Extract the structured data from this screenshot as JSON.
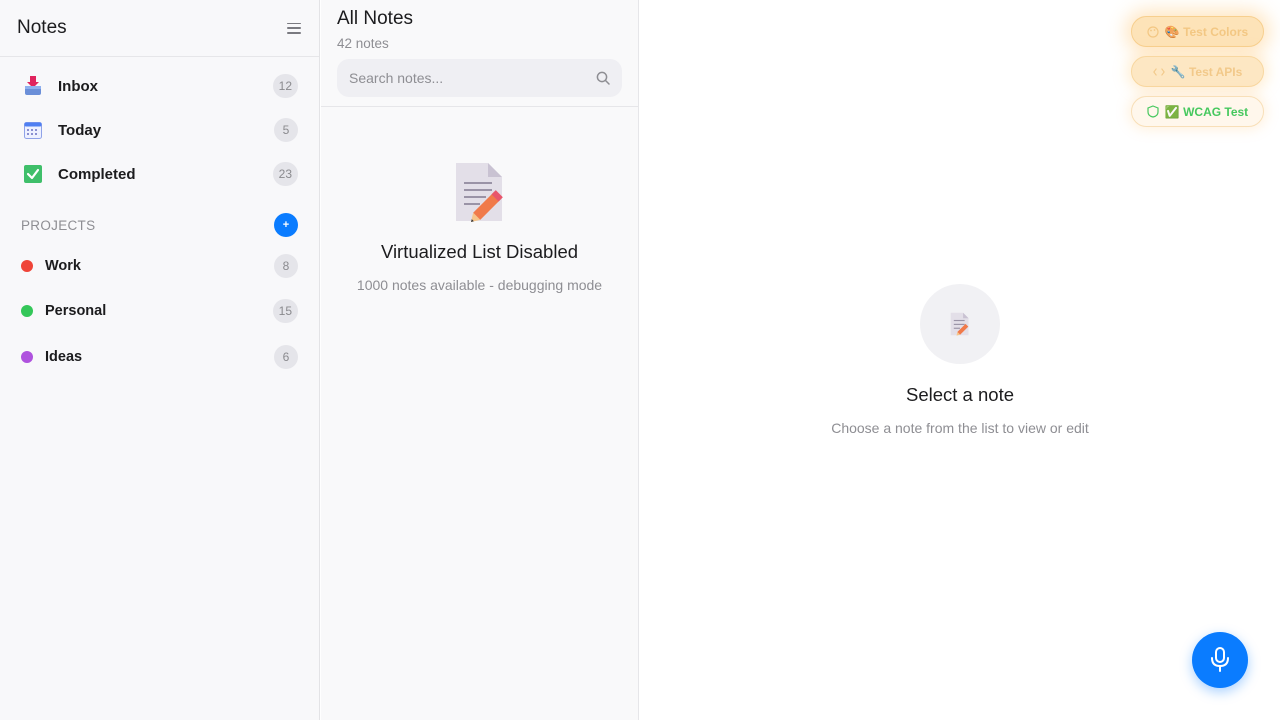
{
  "sidebar": {
    "title": "Notes",
    "menu_icon": "hamburger-menu-icon",
    "items": [
      {
        "label": "Inbox",
        "count": "12",
        "icon": "inbox-tray-icon"
      },
      {
        "label": "Today",
        "count": "5",
        "icon": "calendar-icon"
      },
      {
        "label": "Completed",
        "count": "23",
        "icon": "check-box-icon"
      }
    ],
    "projects_label": "PROJECTS",
    "add_project_label": "+",
    "projects": [
      {
        "label": "Work",
        "count": "8",
        "color": "#ef4438"
      },
      {
        "label": "Personal",
        "count": "15",
        "color": "#34c759"
      },
      {
        "label": "Ideas",
        "count": "6",
        "color": "#af52de"
      }
    ]
  },
  "list": {
    "title": "All Notes",
    "count_text": "42 notes",
    "search_placeholder": "Search notes...",
    "empty_title": "Virtualized List Disabled",
    "empty_subtitle": "1000 notes available - debugging mode"
  },
  "detail": {
    "title": "Select a note",
    "subtitle": "Choose a note from the list to view or edit"
  },
  "test_buttons": {
    "colors_label": "🎨 Test Colors",
    "apis_label": "🔧 Test APIs",
    "wcag_label": "✅ WCAG Test"
  },
  "colors": {
    "accent": "#0a7cff",
    "badge_bg": "#e5e5ea",
    "muted_text": "#8e8e93",
    "wcag_green": "#46c85e"
  }
}
